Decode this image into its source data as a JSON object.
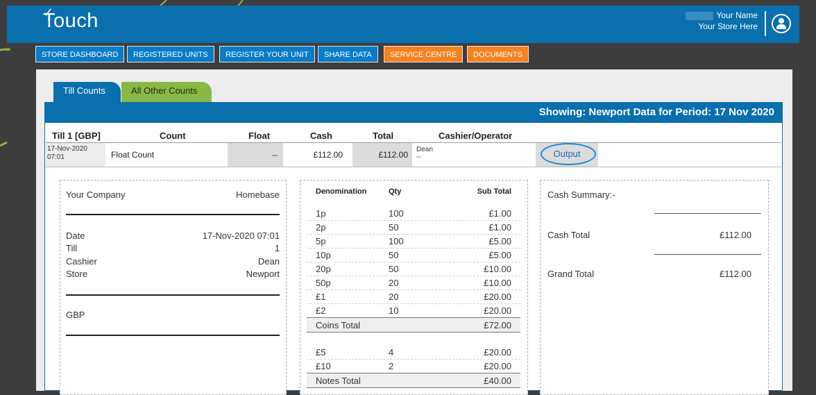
{
  "header": {
    "logo_text": "Touch",
    "logo_check": "✓",
    "user_name": "Your Name",
    "store_label": "Your Store Here"
  },
  "nav": [
    {
      "label": "STORE DASHBOARD",
      "color": "#0a7bc7"
    },
    {
      "label": "REGISTERED UNITS",
      "color": "#0a7bc7"
    },
    {
      "label": "REGISTER YOUR UNIT",
      "color": "#0a7bc7"
    },
    {
      "label": "SHARE DATA",
      "color": "#0a7bc7"
    },
    {
      "label": "SERVICE CENTRE",
      "color": "#f58220"
    },
    {
      "label": "DOCUMENTS",
      "color": "#f58220"
    }
  ],
  "tabs": {
    "active": "Till Counts",
    "other": "All Other Counts"
  },
  "showing": "Showing:  Newport Data for Period: 17 Nov 2020",
  "table": {
    "headers": {
      "till": "Till 1 [GBP]",
      "count": "Count",
      "float": "Float",
      "cash": "Cash",
      "total": "Total",
      "cashier": "Cashier/Operator"
    },
    "row": {
      "date": "17-Nov-2020",
      "time": "07:01",
      "count": "Float Count",
      "float": "--",
      "cash": "£112.00",
      "total": "£112.00",
      "cashier_name": "Dean",
      "cashier_sub": "--",
      "output": "Output"
    }
  },
  "receipt": {
    "company": "Your Company",
    "store_name": "Homebase",
    "date_label": "Date",
    "date_value": "17-Nov-2020 07:01",
    "till_label": "Till",
    "till_value": "1",
    "cashier_label": "Cashier",
    "cashier_value": "Dean",
    "store_label": "Store",
    "store_value": "Newport",
    "currency": "GBP"
  },
  "denominations": {
    "headers": {
      "denomination": "Denomination",
      "qty": "Qty",
      "subtotal": "Sub Total"
    },
    "coins": [
      {
        "d": "1p",
        "q": "100",
        "s": "£1.00"
      },
      {
        "d": "2p",
        "q": "50",
        "s": "£1.00"
      },
      {
        "d": "5p",
        "q": "100",
        "s": "£5.00"
      },
      {
        "d": "10p",
        "q": "50",
        "s": "£5.00"
      },
      {
        "d": "20p",
        "q": "50",
        "s": "£10.00"
      },
      {
        "d": "50p",
        "q": "20",
        "s": "£10.00"
      },
      {
        "d": "£1",
        "q": "20",
        "s": "£20.00"
      },
      {
        "d": "£2",
        "q": "10",
        "s": "£20.00"
      }
    ],
    "coins_total_label": "Coins Total",
    "coins_total": "£72.00",
    "notes": [
      {
        "d": "£5",
        "q": "4",
        "s": "£20.00"
      },
      {
        "d": "£10",
        "q": "2",
        "s": "£20.00"
      }
    ],
    "notes_total_label": "Notes Total",
    "notes_total": "£40.00"
  },
  "summary": {
    "title": "Cash Summary:-",
    "cash_total_label": "Cash Total",
    "cash_total": "£112.00",
    "grand_total_label": "Grand Total",
    "grand_total": "£112.00"
  }
}
